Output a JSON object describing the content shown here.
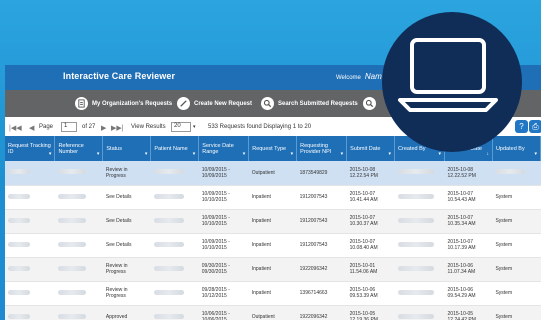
{
  "app": {
    "title": "Interactive Care Reviewer",
    "welcome_label": "Welcome",
    "welcome_name": "Nam"
  },
  "toolbar": {
    "items": [
      {
        "label": "My Organization's Requests",
        "icon": "document-icon"
      },
      {
        "label": "Create New Request",
        "icon": "pencil-icon"
      },
      {
        "label": "Search Submitted Requests",
        "icon": "search-icon"
      }
    ]
  },
  "pager": {
    "first": "|◀◀",
    "prev": "◀",
    "page_label": "Page",
    "page_value": "1",
    "of_label": "of 27",
    "next": "▶",
    "last": "▶▶|",
    "view_results_label": "View Results",
    "view_results_value": "20",
    "summary": "533 Requests found Displaying 1 to 20"
  },
  "table": {
    "columns": [
      "Request Tracking ID",
      "Reference Number",
      "Status",
      "Patient Name",
      "Service Date Range",
      "Request Type",
      "Requesting Provider NPI",
      "Submit Date",
      "Created By",
      "Updated Date",
      "Updated By"
    ],
    "rows": [
      {
        "status": "Review in Progress",
        "service": "10/09/2015 - 10/09/2015",
        "type": "Outpatient",
        "npi": "1873549829",
        "submit": "2015-10-08 12.22.54 PM",
        "updated": "2015-10-08 12.22.52 PM",
        "updated_by": ""
      },
      {
        "status": "See Details",
        "service": "10/09/2015 - 10/10/2015",
        "type": "Inpatient",
        "npi": "1912007543",
        "submit": "2015-10-07 10.41.44 AM",
        "updated": "2015-10-07 10.54.43 AM",
        "updated_by": "System"
      },
      {
        "status": "See Details",
        "service": "10/09/2015 - 10/10/2015",
        "type": "Inpatient",
        "npi": "1912007543",
        "submit": "2015-10-07 10.30.37 AM",
        "updated": "2015-10-07 10.35.34 AM",
        "updated_by": "System"
      },
      {
        "status": "See Details",
        "service": "10/09/2015 - 10/10/2015",
        "type": "Inpatient",
        "npi": "1912007543",
        "submit": "2015-10-07 10.08.40 AM",
        "updated": "2015-10-07 10.17.39 AM",
        "updated_by": "System"
      },
      {
        "status": "Review in Progress",
        "service": "09/30/2015 - 09/30/2015",
        "type": "Inpatient",
        "npi": "1922096342",
        "submit": "2015-10-01 11.54.06 AM",
        "updated": "2015-10-06 11.07.34 AM",
        "updated_by": "System"
      },
      {
        "status": "Review in Progress",
        "service": "09/28/2015 - 10/12/2015",
        "type": "Inpatient",
        "npi": "1396714663",
        "submit": "2015-10-06 09.53.39 AM",
        "updated": "2015-10-06 09.54.29 AM",
        "updated_by": "System"
      },
      {
        "status": "Approved",
        "service": "10/06/2015 - 10/06/2015",
        "type": "Outpatient",
        "npi": "1922096342",
        "submit": "2015-10-05 12.19.36 PM",
        "updated": "2015-10-05 12.24.42 PM",
        "updated_by": "System"
      }
    ]
  },
  "colors": {
    "background": "#2ba4df",
    "header": "#1f6fb7",
    "toolbar": "#636466",
    "badge": "#0f2d57"
  },
  "badge": {
    "icon": "laptop-icon"
  }
}
